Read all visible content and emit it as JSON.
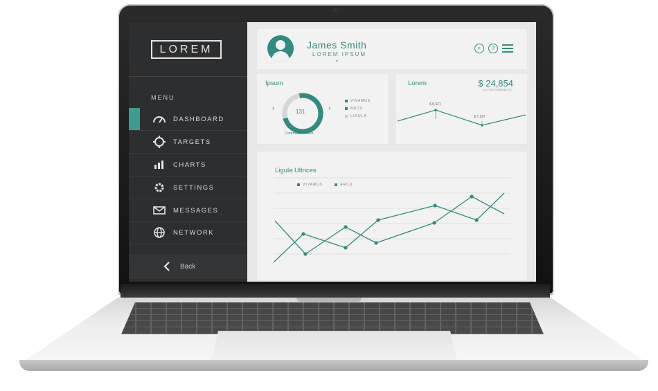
{
  "sidebar": {
    "logo": "LOREM",
    "menu_label": "MENU",
    "items": [
      {
        "label": "DASHBOARD",
        "icon": "speedometer-icon"
      },
      {
        "label": "TARGETS",
        "icon": "target-icon"
      },
      {
        "label": "CHARTS",
        "icon": "bar-chart-icon"
      },
      {
        "label": "SETTINGS",
        "icon": "gear-icon"
      },
      {
        "label": "MESSAGES",
        "icon": "envelope-icon"
      },
      {
        "label": "NETWORK",
        "icon": "globe-icon"
      }
    ],
    "back_label": "Back"
  },
  "header": {
    "name": "James Smith",
    "subtitle": "LOREM IPSUM",
    "icons": [
      "search-icon",
      "help-icon",
      "menu-icon"
    ]
  },
  "ipsum_card": {
    "title": "Ipsum",
    "value": "131",
    "caption": "Commodo lectus",
    "legend": [
      "VIVAMUS",
      "ARCU",
      "LIGULA"
    ]
  },
  "lorem_card": {
    "title": "Lorem",
    "value": "$ 24,854",
    "caption": "LUCTUS VENENATIS",
    "point_labels": [
      "$ 5,421",
      "$ 7,227"
    ]
  },
  "ligula_card": {
    "title": "Ligula Ultrices",
    "legend": [
      "VIVAMUS",
      "ARCU"
    ]
  },
  "colors": {
    "accent": "#2f8c7e",
    "sidebar": "#2d2e2f",
    "panel": "#f1f2f1"
  }
}
